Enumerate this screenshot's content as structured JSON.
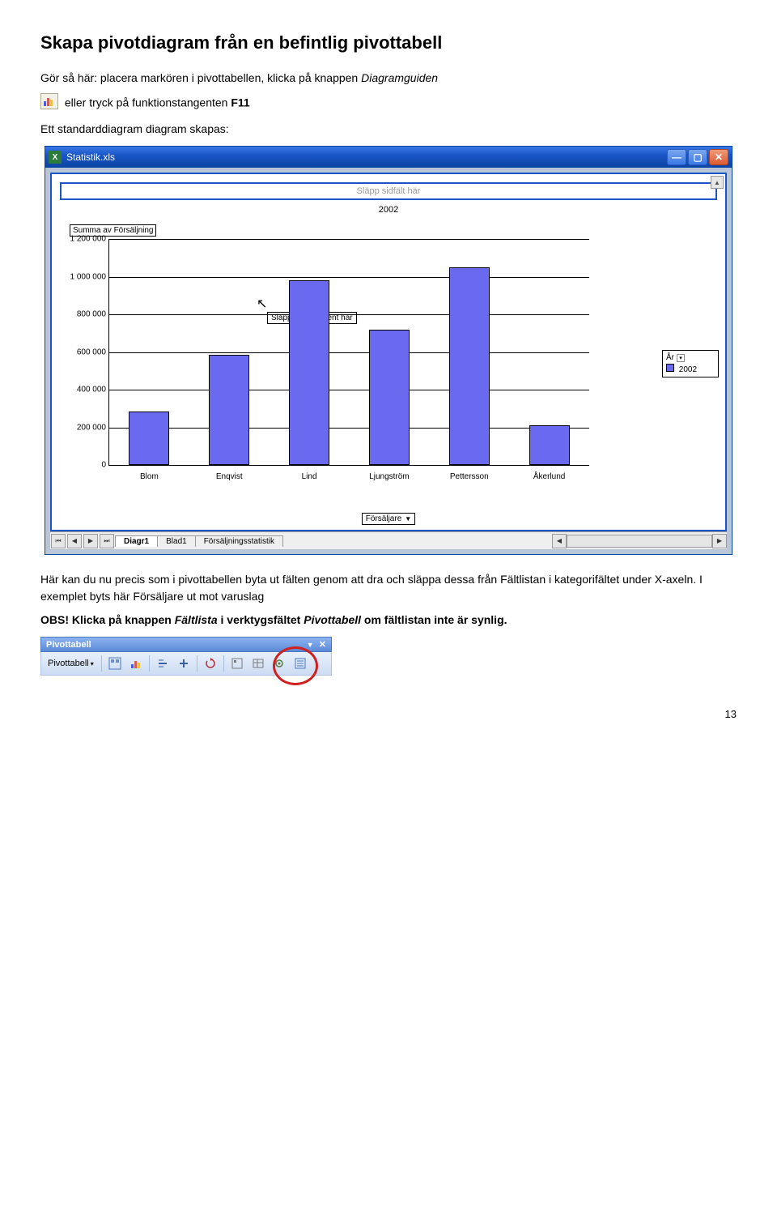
{
  "heading": "Skapa pivotdiagram från en befintlig pivottabell",
  "intro_line1_part1": "Gör så här: placera markören i pivottabellen, klicka på knappen ",
  "intro_line1_part2": "Diagramguiden",
  "intro_line2_part1": " eller tryck på funktionstangenten ",
  "intro_line2_key": "F11",
  "intro_line3": "Ett standarddiagram diagram skapas:",
  "window": {
    "title": "Statistik.xls",
    "dropzone_top": "Släpp sidfält här",
    "overlay_cell": "Släpp dataelement här"
  },
  "chart_data": {
    "type": "bar",
    "title": "2002",
    "ylabel_box": "Summa av Försäljning",
    "categories": [
      "Blom",
      "Enqvist",
      "Lind",
      "Ljungström",
      "Pettersson",
      "Åkerlund"
    ],
    "values": [
      285000,
      585000,
      980000,
      720000,
      1050000,
      210000
    ],
    "yticks": [
      0,
      200000,
      400000,
      600000,
      800000,
      1000000,
      1200000
    ],
    "ytick_labels": [
      "0",
      "200 000",
      "400 000",
      "600 000",
      "800 000",
      "1 000 000",
      "1 200 000"
    ],
    "ylim": [
      0,
      1200000
    ],
    "footer_dropdown": "Försäljare",
    "legend": {
      "field": "År",
      "item": "2002"
    }
  },
  "tabs": {
    "active": "Diagr1",
    "items": [
      "Diagr1",
      "Blad1",
      "Försäljningsstatistik"
    ]
  },
  "para2": "Här kan du nu precis som i pivottabellen byta ut fälten genom att dra och släppa dessa från Fältlistan i kategorifältet under X-axeln. I exemplet byts här Försäljare ut mot varuslag",
  "para3_bold_prefix": "OBS! Klicka på knappen ",
  "para3_bold_mid": "Fältlista",
  "para3_bold_suffix": " i verktygsfältet ",
  "para3_bold_mid2": "Pivottabell",
  "para3_bold_end": " om fältlistan inte är synlig.",
  "toolbar": {
    "title": "Pivottabell",
    "menu_label": "Pivottabell"
  },
  "page_number": "13"
}
